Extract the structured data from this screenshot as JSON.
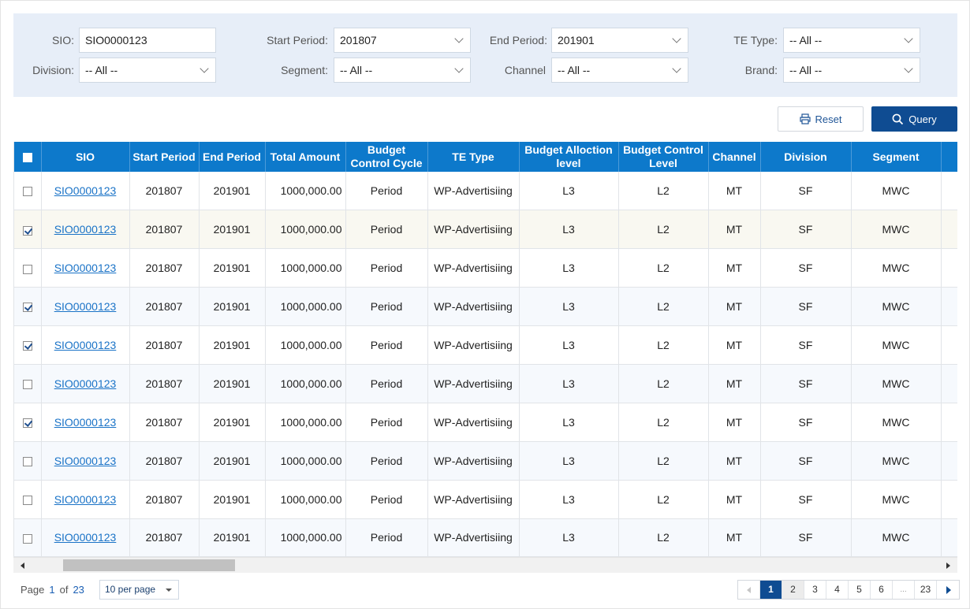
{
  "filters": {
    "sio_label": "SIO:",
    "sio_value": "SIO0000123",
    "start_period_label": "Start Period:",
    "start_period_value": "201807",
    "end_period_label": "End Period:",
    "end_period_value": "201901",
    "te_type_label": "TE Type:",
    "te_type_value": "-- All --",
    "division_label": "Division:",
    "division_value": "-- All --",
    "segment_label": "Segment:",
    "segment_value": "-- All --",
    "channel_label": "Channel",
    "channel_value": "-- All --",
    "brand_label": "Brand:",
    "brand_value": "-- All --"
  },
  "actions": {
    "reset_label": "Reset",
    "query_label": "Query"
  },
  "table": {
    "columns": [
      "SIO",
      "Start Period",
      "End Period",
      "Total Amount",
      "Budget Control Cycle",
      "TE Type",
      "Budget Alloction level",
      "Budget Control Level",
      "Channel",
      "Division",
      "Segment",
      "B"
    ],
    "rows": [
      {
        "checked": false,
        "sio": "SIO0000123",
        "start": "201807",
        "end": "201901",
        "amount": "1000,000.00",
        "cycle": "Period",
        "te": "WP-Advertisiing",
        "alloc": "L3",
        "control": "L2",
        "channel": "MT",
        "division": "SF",
        "segment": "MWC",
        "extra": "I"
      },
      {
        "checked": true,
        "sio": "SIO0000123",
        "start": "201807",
        "end": "201901",
        "amount": "1000,000.00",
        "cycle": "Period",
        "te": "WP-Advertisiing",
        "alloc": "L3",
        "control": "L2",
        "channel": "MT",
        "division": "SF",
        "segment": "MWC",
        "extra": "I"
      },
      {
        "checked": false,
        "sio": "SIO0000123",
        "start": "201807",
        "end": "201901",
        "amount": "1000,000.00",
        "cycle": "Period",
        "te": "WP-Advertisiing",
        "alloc": "L3",
        "control": "L2",
        "channel": "MT",
        "division": "SF",
        "segment": "MWC",
        "extra": "I"
      },
      {
        "checked": true,
        "sio": "SIO0000123",
        "start": "201807",
        "end": "201901",
        "amount": "1000,000.00",
        "cycle": "Period",
        "te": "WP-Advertisiing",
        "alloc": "L3",
        "control": "L2",
        "channel": "MT",
        "division": "SF",
        "segment": "MWC",
        "extra": "I"
      },
      {
        "checked": true,
        "sio": "SIO0000123",
        "start": "201807",
        "end": "201901",
        "amount": "1000,000.00",
        "cycle": "Period",
        "te": "WP-Advertisiing",
        "alloc": "L3",
        "control": "L2",
        "channel": "MT",
        "division": "SF",
        "segment": "MWC",
        "extra": "I"
      },
      {
        "checked": false,
        "sio": "SIO0000123",
        "start": "201807",
        "end": "201901",
        "amount": "1000,000.00",
        "cycle": "Period",
        "te": "WP-Advertisiing",
        "alloc": "L3",
        "control": "L2",
        "channel": "MT",
        "division": "SF",
        "segment": "MWC",
        "extra": "I"
      },
      {
        "checked": true,
        "sio": "SIO0000123",
        "start": "201807",
        "end": "201901",
        "amount": "1000,000.00",
        "cycle": "Period",
        "te": "WP-Advertisiing",
        "alloc": "L3",
        "control": "L2",
        "channel": "MT",
        "division": "SF",
        "segment": "MWC",
        "extra": "I"
      },
      {
        "checked": false,
        "sio": "SIO0000123",
        "start": "201807",
        "end": "201901",
        "amount": "1000,000.00",
        "cycle": "Period",
        "te": "WP-Advertisiing",
        "alloc": "L3",
        "control": "L2",
        "channel": "MT",
        "division": "SF",
        "segment": "MWC",
        "extra": "I"
      },
      {
        "checked": false,
        "sio": "SIO0000123",
        "start": "201807",
        "end": "201901",
        "amount": "1000,000.00",
        "cycle": "Period",
        "te": "WP-Advertisiing",
        "alloc": "L3",
        "control": "L2",
        "channel": "MT",
        "division": "SF",
        "segment": "MWC",
        "extra": "I"
      },
      {
        "checked": false,
        "sio": "SIO0000123",
        "start": "201807",
        "end": "201901",
        "amount": "1000,000.00",
        "cycle": "Period",
        "te": "WP-Advertisiing",
        "alloc": "L3",
        "control": "L2",
        "channel": "MT",
        "division": "SF",
        "segment": "MWC",
        "extra": "I"
      }
    ]
  },
  "footer": {
    "page_word": "Page",
    "current_page": "1",
    "of_word": "of",
    "total_pages": "23",
    "per_page": "10 per page",
    "pager_pages": [
      "1",
      "2",
      "3",
      "4",
      "5",
      "6",
      "...",
      "23"
    ]
  },
  "icons": {
    "reset": "printer-icon",
    "query": "search-icon"
  },
  "colors": {
    "header_blue": "#0d79cb",
    "primary_button": "#0f4c92",
    "filter_panel": "#e7eef8",
    "link": "#1a73c7"
  }
}
